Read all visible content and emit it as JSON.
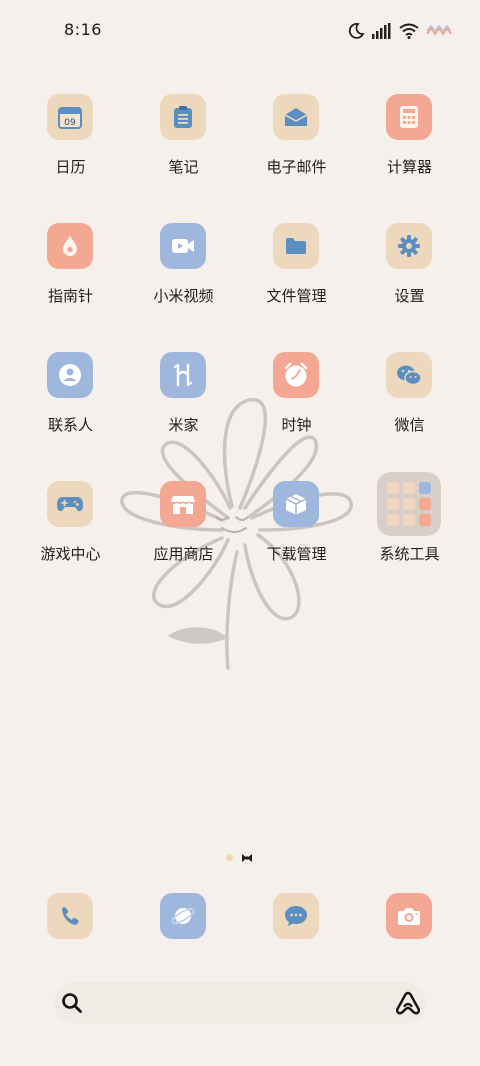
{
  "status_bar": {
    "time": "8:16",
    "icons": [
      "moon-icon",
      "signal-icon",
      "wifi-icon",
      "battery-icon"
    ]
  },
  "apps": [
    {
      "name": "calendar",
      "label": "日历",
      "icon": "calendar-icon",
      "color": "#eed8bd",
      "date": "09"
    },
    {
      "name": "notes",
      "label": "笔记",
      "icon": "clipboard-icon",
      "color": "#eed8bd"
    },
    {
      "name": "email",
      "label": "电子邮件",
      "icon": "envelope-icon",
      "color": "#eed8bd"
    },
    {
      "name": "calculator",
      "label": "计算器",
      "icon": "calculator-icon",
      "color": "#f4a894"
    },
    {
      "name": "compass",
      "label": "指南针",
      "icon": "drop-icon",
      "color": "#f4a894"
    },
    {
      "name": "mi-video",
      "label": "小米视频",
      "icon": "video-icon",
      "color": "#9fb7dd"
    },
    {
      "name": "file-manager",
      "label": "文件管理",
      "icon": "folder-icon",
      "color": "#eed8bd"
    },
    {
      "name": "settings",
      "label": "设置",
      "icon": "gear-icon",
      "color": "#eed8bd"
    },
    {
      "name": "contacts",
      "label": "联系人",
      "icon": "person-icon",
      "color": "#9fb7dd"
    },
    {
      "name": "mi-home",
      "label": "米家",
      "icon": "mihome-icon",
      "color": "#9fb7dd"
    },
    {
      "name": "clock",
      "label": "时钟",
      "icon": "alarm-clock-icon",
      "color": "#f4a894"
    },
    {
      "name": "wechat",
      "label": "微信",
      "icon": "wechat-icon",
      "color": "#eed8bd"
    },
    {
      "name": "game-center",
      "label": "游戏中心",
      "icon": "gamepad-icon",
      "color": "#eed8bd"
    },
    {
      "name": "app-store",
      "label": "应用商店",
      "icon": "store-icon",
      "color": "#f4a894"
    },
    {
      "name": "downloads",
      "label": "下载管理",
      "icon": "box-icon",
      "color": "#9fb7dd"
    },
    {
      "name": "system-tools",
      "label": "系统工具",
      "icon": "folder-grid-icon",
      "color": "#d9cfc8"
    }
  ],
  "folder_tiles": [
    "#eed8bd",
    "#eed8bd",
    "#9fb7dd",
    "#eed8bd",
    "#eed8bd",
    "#f4a894",
    "#eed8bd",
    "#eed8bd",
    "#f4a894"
  ],
  "dock": [
    {
      "name": "phone",
      "icon": "phone-icon",
      "color": "#eed8bd"
    },
    {
      "name": "browser",
      "icon": "planet-icon",
      "color": "#9fb7dd"
    },
    {
      "name": "messages",
      "icon": "chat-bubble-icon",
      "color": "#eed8bd"
    },
    {
      "name": "camera",
      "icon": "camera-icon",
      "color": "#f4a894"
    }
  ],
  "page_indicator": {
    "pages": 2,
    "current": 2
  },
  "search": {
    "icon": "search-icon",
    "assistant_icon": "assistant-icon"
  }
}
